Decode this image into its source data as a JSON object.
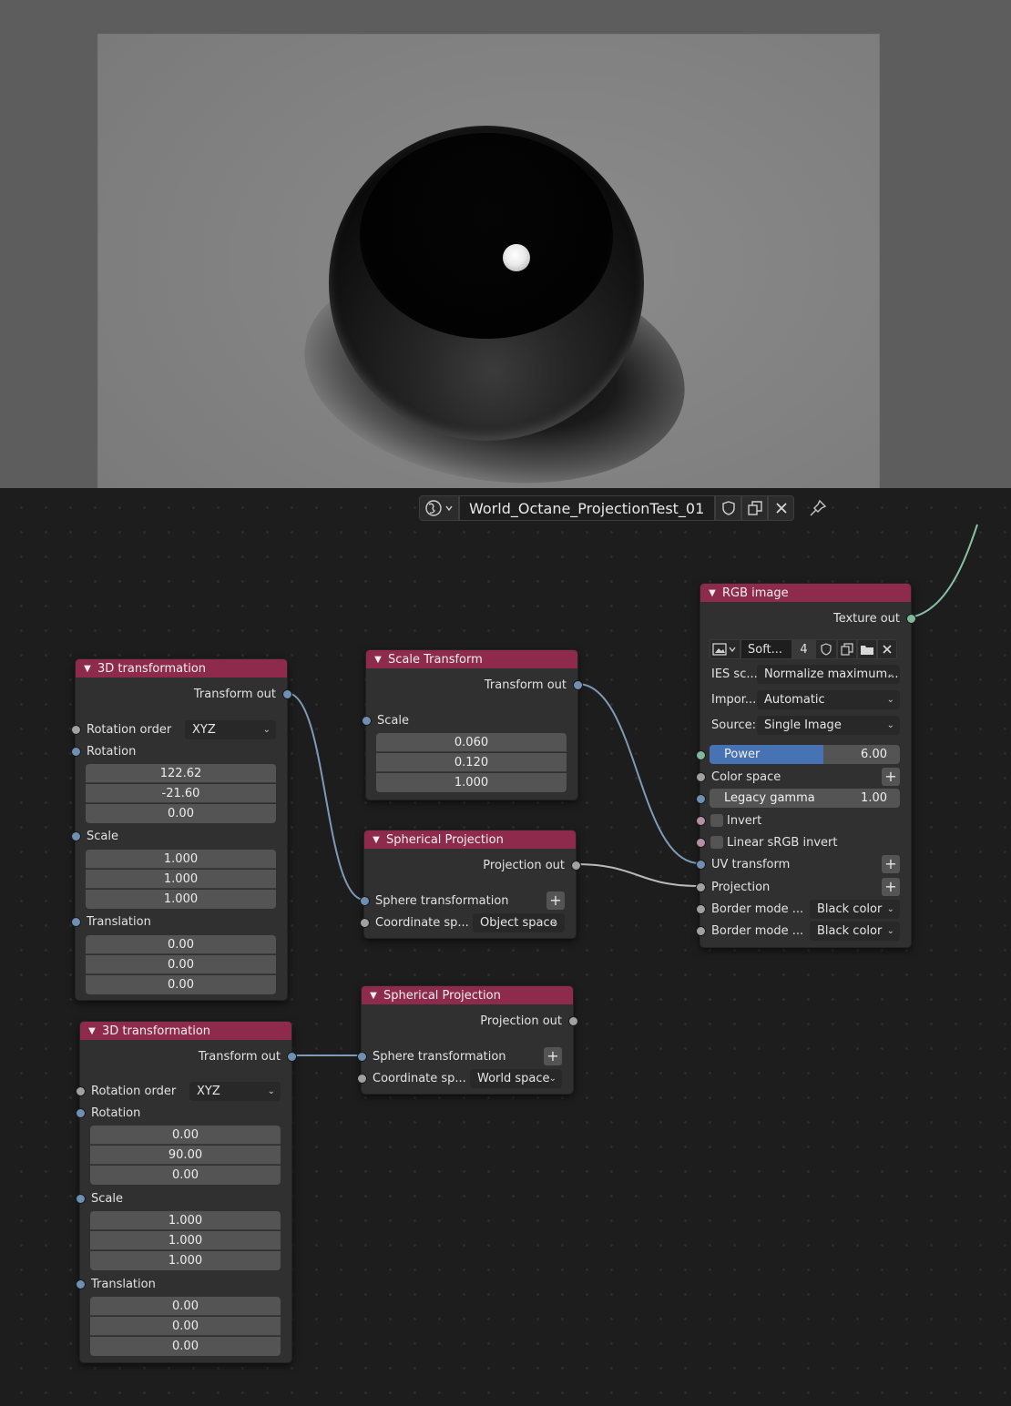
{
  "header": {
    "material_name": "World_Octane_ProjectionTest_01"
  },
  "nodes": {
    "transform_a": {
      "title": "3D transformation",
      "output": "Transform out",
      "rotation_order_label": "Rotation order",
      "rotation_order_value": "XYZ",
      "rotation_label": "Rotation",
      "rotation": [
        "122.62",
        "-21.60",
        "0.00"
      ],
      "scale_label": "Scale",
      "scale": [
        "1.000",
        "1.000",
        "1.000"
      ],
      "translation_label": "Translation",
      "translation": [
        "0.00",
        "0.00",
        "0.00"
      ]
    },
    "transform_b": {
      "title": "3D transformation",
      "output": "Transform out",
      "rotation_order_label": "Rotation order",
      "rotation_order_value": "XYZ",
      "rotation_label": "Rotation",
      "rotation": [
        "0.00",
        "90.00",
        "0.00"
      ],
      "scale_label": "Scale",
      "scale": [
        "1.000",
        "1.000",
        "1.000"
      ],
      "translation_label": "Translation",
      "translation": [
        "0.00",
        "0.00",
        "0.00"
      ]
    },
    "scale_transform": {
      "title": "Scale Transform",
      "output": "Transform out",
      "scale_label": "Scale",
      "scale": [
        "0.060",
        "0.120",
        "1.000"
      ]
    },
    "spherical_a": {
      "title": "Spherical Projection",
      "output": "Projection out",
      "sphere_label": "Sphere transformation",
      "coord_label": "Coordinate sp...",
      "coord_value": "Object space"
    },
    "spherical_b": {
      "title": "Spherical Projection",
      "output": "Projection out",
      "sphere_label": "Sphere transformation",
      "coord_label": "Coordinate sp...",
      "coord_value": "World space"
    },
    "rgb_image": {
      "title": "RGB image",
      "output": "Texture out",
      "image_name": "Soft...",
      "image_users": "4",
      "ies_label": "IES sc...",
      "ies_value": "Normalize maximum...",
      "import_label": "Impor...",
      "import_value": "Automatic",
      "source_label": "Source:",
      "source_value": "Single Image",
      "power_label": "Power",
      "power_value": "6.00",
      "power_fill": 0.6,
      "color_space_label": "Color space",
      "legacy_gamma_label": "Legacy gamma",
      "legacy_gamma_value": "1.00",
      "invert_label": "Invert",
      "linear_srgb_label": "Linear sRGB invert",
      "uv_transform_label": "UV transform",
      "projection_label": "Projection",
      "border_u_label": "Border mode ...",
      "border_u_value": "Black color",
      "border_v_label": "Border mode ...",
      "border_v_value": "Black color"
    }
  },
  "colors": {
    "node_header": "#8e2a4c",
    "wire_transform": "#7e9ab8",
    "wire_projection": "#b9b9b9",
    "wire_texture": "#86c2a3",
    "slider_fill": "#4772b3"
  }
}
